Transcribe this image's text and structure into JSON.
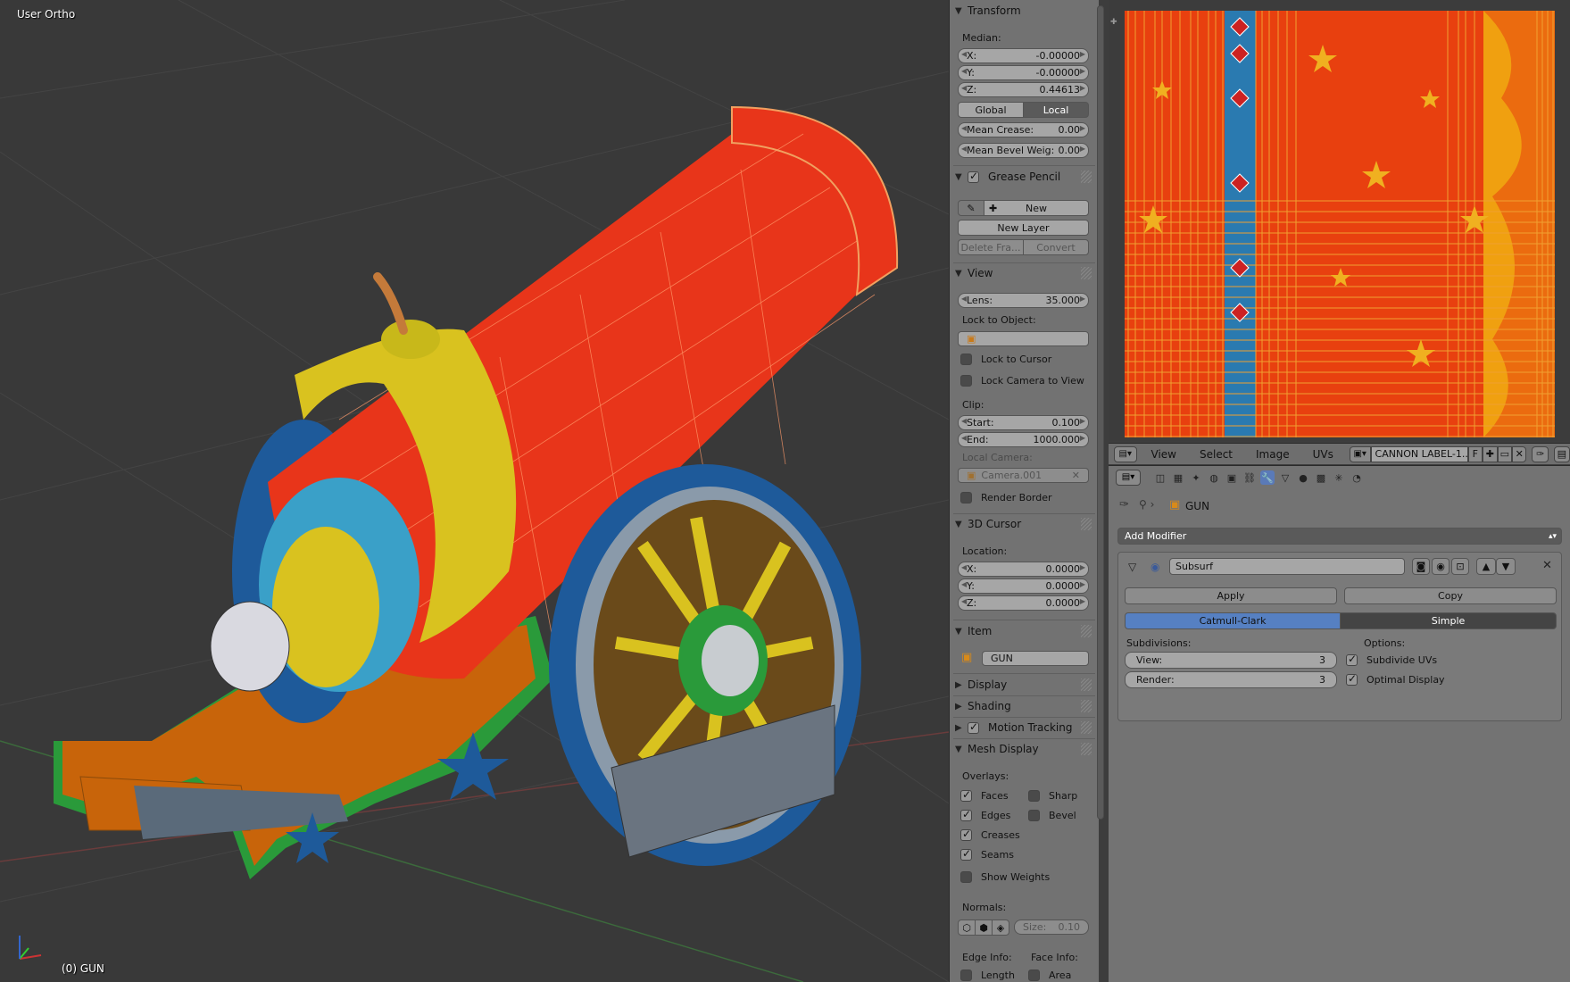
{
  "viewport": {
    "view_name": "User Ortho",
    "object_info": "(0) GUN",
    "colors": {
      "barrel": "#e8351a",
      "gold": "#d9c21f",
      "blue": "#1e5a9a",
      "wood": "#c8640a",
      "green": "#2a9a3a",
      "steel": "#8a9aaa"
    }
  },
  "npanel": {
    "transform": {
      "header": "Transform",
      "median_label": "Median:",
      "x_label": "X:",
      "x_value": "-0.00000",
      "y_label": "Y:",
      "y_value": "-0.00000",
      "z_label": "Z:",
      "z_value": "0.44613",
      "global": "Global",
      "local": "Local",
      "crease_label": "Mean Crease:",
      "crease_value": "0.00",
      "bevel_label": "Mean Bevel Weig:",
      "bevel_value": "0.00"
    },
    "grease": {
      "header": "Grease Pencil",
      "new": "New",
      "new_layer": "New Layer",
      "delete_frame": "Delete Fra...",
      "convert": "Convert"
    },
    "view": {
      "header": "View",
      "lens_label": "Lens:",
      "lens_value": "35.000",
      "lock_object": "Lock to Object:",
      "lock_cursor": "Lock to Cursor",
      "lock_camera": "Lock Camera to View",
      "clip": "Clip:",
      "start_label": "Start:",
      "start_value": "0.100",
      "end_label": "End:",
      "end_value": "1000.000",
      "local_camera": "Local Camera:",
      "camera_value": "Camera.001",
      "render_border": "Render Border"
    },
    "cursor": {
      "header": "3D Cursor",
      "location": "Location:",
      "x_label": "X:",
      "x_value": "0.0000",
      "y_label": "Y:",
      "y_value": "0.0000",
      "z_label": "Z:",
      "z_value": "0.0000"
    },
    "item": {
      "header": "Item",
      "name": "GUN"
    },
    "display": {
      "header": "Display"
    },
    "shading": {
      "header": "Shading"
    },
    "motion": {
      "header": "Motion Tracking"
    },
    "mesh": {
      "header": "Mesh Display",
      "overlays": "Overlays:",
      "faces": "Faces",
      "sharp": "Sharp",
      "edges": "Edges",
      "bevel": "Bevel",
      "creases": "Creases",
      "seams": "Seams",
      "show_weights": "Show Weights",
      "normals": "Normals:",
      "size_label": "Size:",
      "size_value": "0.10",
      "edge_info": "Edge Info:",
      "face_info": "Face Info:",
      "length": "Length",
      "area": "Area"
    }
  },
  "uv_header": {
    "view": "View",
    "select": "Select",
    "image": "Image",
    "uvs": "UVs",
    "image_name": "CANNON LABEL-1....",
    "f": "F"
  },
  "properties": {
    "object_name": "GUN",
    "add_modifier": "Add Modifier",
    "modifier_name": "Subsurf",
    "apply": "Apply",
    "copy": "Copy",
    "catmull": "Catmull-Clark",
    "simple": "Simple",
    "subdivisions": "Subdivisions:",
    "options": "Options:",
    "view_label": "View:",
    "view_value": "3",
    "render_label": "Render:",
    "render_value": "3",
    "subdivide_uvs": "Subdivide UVs",
    "optimal_display": "Optimal Display"
  }
}
